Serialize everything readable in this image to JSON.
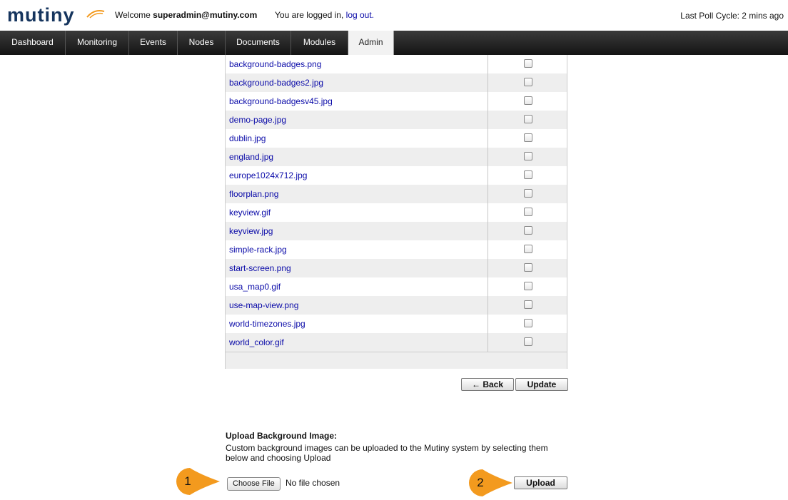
{
  "header": {
    "logo_text": "mutiny",
    "welcome_prefix": "Welcome",
    "username": "superadmin@mutiny.com",
    "logged_in_text": "You are logged in,",
    "logout_link": "log out.",
    "poll_text": "Last Poll Cycle: 2 mins ago"
  },
  "nav": {
    "tabs": [
      {
        "label": "Dashboard"
      },
      {
        "label": "Monitoring"
      },
      {
        "label": "Events"
      },
      {
        "label": "Nodes"
      },
      {
        "label": "Documents"
      },
      {
        "label": "Modules"
      },
      {
        "label": "Admin",
        "active": true
      }
    ]
  },
  "files": [
    "background-badges.png",
    "background-badges2.jpg",
    "background-badgesv45.jpg",
    "demo-page.jpg",
    "dublin.jpg",
    "england.jpg",
    "europe1024x712.jpg",
    "floorplan.png",
    "keyview.gif",
    "keyview.jpg",
    "simple-rack.jpg",
    "start-screen.png",
    "usa_map0.gif",
    "use-map-view.png",
    "world-timezones.jpg",
    "world_color.gif"
  ],
  "actions": {
    "back_label": "← Back",
    "update_label": "Update"
  },
  "upload": {
    "title": "Upload Background Image:",
    "description": "Custom background images can be uploaded to the Mutiny system by selecting them below and choosing Upload",
    "choose_label": "Choose File",
    "no_file_text": "No file chosen",
    "upload_label": "Upload"
  },
  "callouts": {
    "one": "1",
    "two": "2",
    "color": "#f39a1e"
  },
  "colors": {
    "brand": "#16355e",
    "link": "#0a0aa8",
    "accent": "#f39a1e"
  }
}
